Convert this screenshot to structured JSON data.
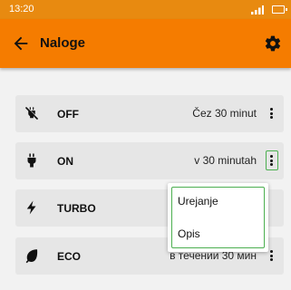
{
  "status_bar": {
    "time": "13:20"
  },
  "app_bar": {
    "title": "Naloge"
  },
  "rows": [
    {
      "name": "OFF",
      "schedule": "Čez 30 minut",
      "icon": "plug-off-icon"
    },
    {
      "name": "ON",
      "schedule": "v 30 minutah",
      "icon": "plug-icon"
    },
    {
      "name": "TURBO",
      "schedule": "",
      "icon": "lightning-icon"
    },
    {
      "name": "ECO",
      "schedule": "в течении 30 мин",
      "icon": "leaf-icon"
    }
  ],
  "context_menu": {
    "items": [
      "Urejanje",
      "Opis"
    ]
  },
  "colors": {
    "accent": "#f57c00",
    "status_bar": "#e88a10",
    "focus": "#4caf50"
  }
}
